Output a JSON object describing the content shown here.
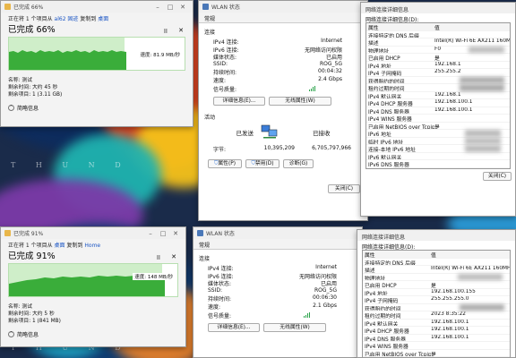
{
  "wallpaper": {
    "watermark_top": "T H U N D",
    "watermark_bottom": "T H U N D"
  },
  "copy1": {
    "title": "已完成 66%",
    "from_prefix": "正在将 1 个项目从 ",
    "from_src": "al62 固迹",
    "from_mid": " 复制到 ",
    "from_dst": "桌面",
    "percent": "已完成 66%",
    "pause": "II",
    "speed": "速度: 81.9 MB/秒",
    "progress": 0.66,
    "name": "名称: 测试",
    "remaining": "剩余时间: 大约 45 秒",
    "items": "剩余项目: 1 (3.11 GB)",
    "less": "简略信息"
  },
  "copy2": {
    "title": "已完成 91%",
    "from_prefix": "正在将 1 个项目从 ",
    "from_src": "桌面",
    "from_mid": " 复制到 ",
    "from_dst": "Home",
    "percent": "已完成 91%",
    "pause": "II",
    "speed": "速度: 148 MB/秒",
    "progress": 0.91,
    "name": "名称: 测试",
    "remaining": "剩余时间: 大约 5 秒",
    "items": "剩余项目: 1 (841 MB)",
    "less": "简略信息"
  },
  "wlan1": {
    "title": "WLAN 状态",
    "tab": "常规",
    "conn_group": "连接",
    "rows": [
      {
        "k": "IPv4 连接:",
        "v": "Internet"
      },
      {
        "k": "IPv6 连接:",
        "v": "无网络访问权限"
      },
      {
        "k": "媒体状态:",
        "v": "已启用"
      },
      {
        "k": "SSID:",
        "v": "ROG_5G"
      },
      {
        "k": "持续时间:",
        "v": "00:04:32"
      },
      {
        "k": "速度:",
        "v": "2.4 Gbps"
      }
    ],
    "signal_label": "信号质量:",
    "btn_details": "详细信息(E)...",
    "btn_wireless": "无线属性(W)",
    "activity_group": "活动",
    "sent_label": "已发送",
    "recv_label": "已接收",
    "bytes_label": "字节:",
    "bytes_sent": "10,395,209",
    "bytes_recv": "6,705,797,966",
    "btn_props": "属性(P)",
    "btn_disable": "禁用(D)",
    "btn_diag": "诊断(G)",
    "btn_close": "关闭(C)"
  },
  "wlan2": {
    "title": "WLAN 状态",
    "tab": "常规",
    "conn_group": "连接",
    "rows": [
      {
        "k": "IPv4 连接:",
        "v": "Internet"
      },
      {
        "k": "IPv6 连接:",
        "v": "无网络访问权限"
      },
      {
        "k": "媒体状态:",
        "v": "已启用"
      },
      {
        "k": "SSID:",
        "v": "ROG_5G"
      },
      {
        "k": "持续时间:",
        "v": "00:06:30"
      },
      {
        "k": "速度:",
        "v": "2.1 Gbps"
      }
    ],
    "signal_label": "信号质量:",
    "btn_details": "详细信息(E)...",
    "btn_wireless": "无线属性(W)"
  },
  "details1": {
    "title": "网络连接详细信息",
    "label": "网络连接详细信息(D):",
    "col_prop": "属性",
    "col_val": "值",
    "rows": [
      {
        "p": "连接特定的 DNS 后缀",
        "v": ""
      },
      {
        "p": "描述",
        "v": "Intel(R) Wi-Fi 6E AX211 160MHz"
      },
      {
        "p": "物理地址",
        "v": "F0"
      },
      {
        "p": "已启用 DHCP",
        "v": "是"
      },
      {
        "p": "IPv4 地址",
        "v": "192.168.1"
      },
      {
        "p": "IPv4 子网掩码",
        "v": "255.255.2"
      },
      {
        "p": "获得租约的时间",
        "v": ""
      },
      {
        "p": "租约过期的时间",
        "v": ""
      },
      {
        "p": "IPv4 默认网关",
        "v": "192.168.1"
      },
      {
        "p": "IPv4 DHCP 服务器",
        "v": "192.168.100.1"
      },
      {
        "p": "IPv4 DNS 服务器",
        "v": "192.168.100.1"
      },
      {
        "p": "IPv4 WINS 服务器",
        "v": ""
      },
      {
        "p": "已启用 NetBIOS over Tcpip",
        "v": "是"
      },
      {
        "p": "IPv6 地址",
        "v": ""
      },
      {
        "p": "临时 IPv6 地址",
        "v": ""
      },
      {
        "p": "连接-本地 IPv6 地址",
        "v": ""
      },
      {
        "p": "IPv6 默认网关",
        "v": ""
      },
      {
        "p": "IPv6 DNS 服务器",
        "v": ""
      }
    ],
    "btn_close": "关闭(C)"
  },
  "details2": {
    "title": "网络连接详细信息",
    "label": "网络连接详细信息(D):",
    "col_prop": "属性",
    "col_val": "值",
    "rows": [
      {
        "p": "连接特定的 DNS 后缀",
        "v": ""
      },
      {
        "p": "描述",
        "v": "Intel(R) Wi-Fi 6E AX211 160MHz"
      },
      {
        "p": "物理地址",
        "v": ""
      },
      {
        "p": "已启用 DHCP",
        "v": "是"
      },
      {
        "p": "IPv4 地址",
        "v": "192.168.100.155"
      },
      {
        "p": "IPv4 子网掩码",
        "v": "255.255.255.0"
      },
      {
        "p": "获得租约的时间",
        "v": ""
      },
      {
        "p": "租约过期的时间",
        "v": "2023 8:35:22"
      },
      {
        "p": "IPv4 默认网关",
        "v": "192.168.100.1"
      },
      {
        "p": "IPv4 DHCP 服务器",
        "v": "192.168.100.1"
      },
      {
        "p": "IPv4 DNS 服务器",
        "v": "192.168.100.1"
      },
      {
        "p": "IPv4 WINS 服务器",
        "v": ""
      },
      {
        "p": "已启用 NetBIOS over Tcpip",
        "v": "是"
      }
    ]
  }
}
